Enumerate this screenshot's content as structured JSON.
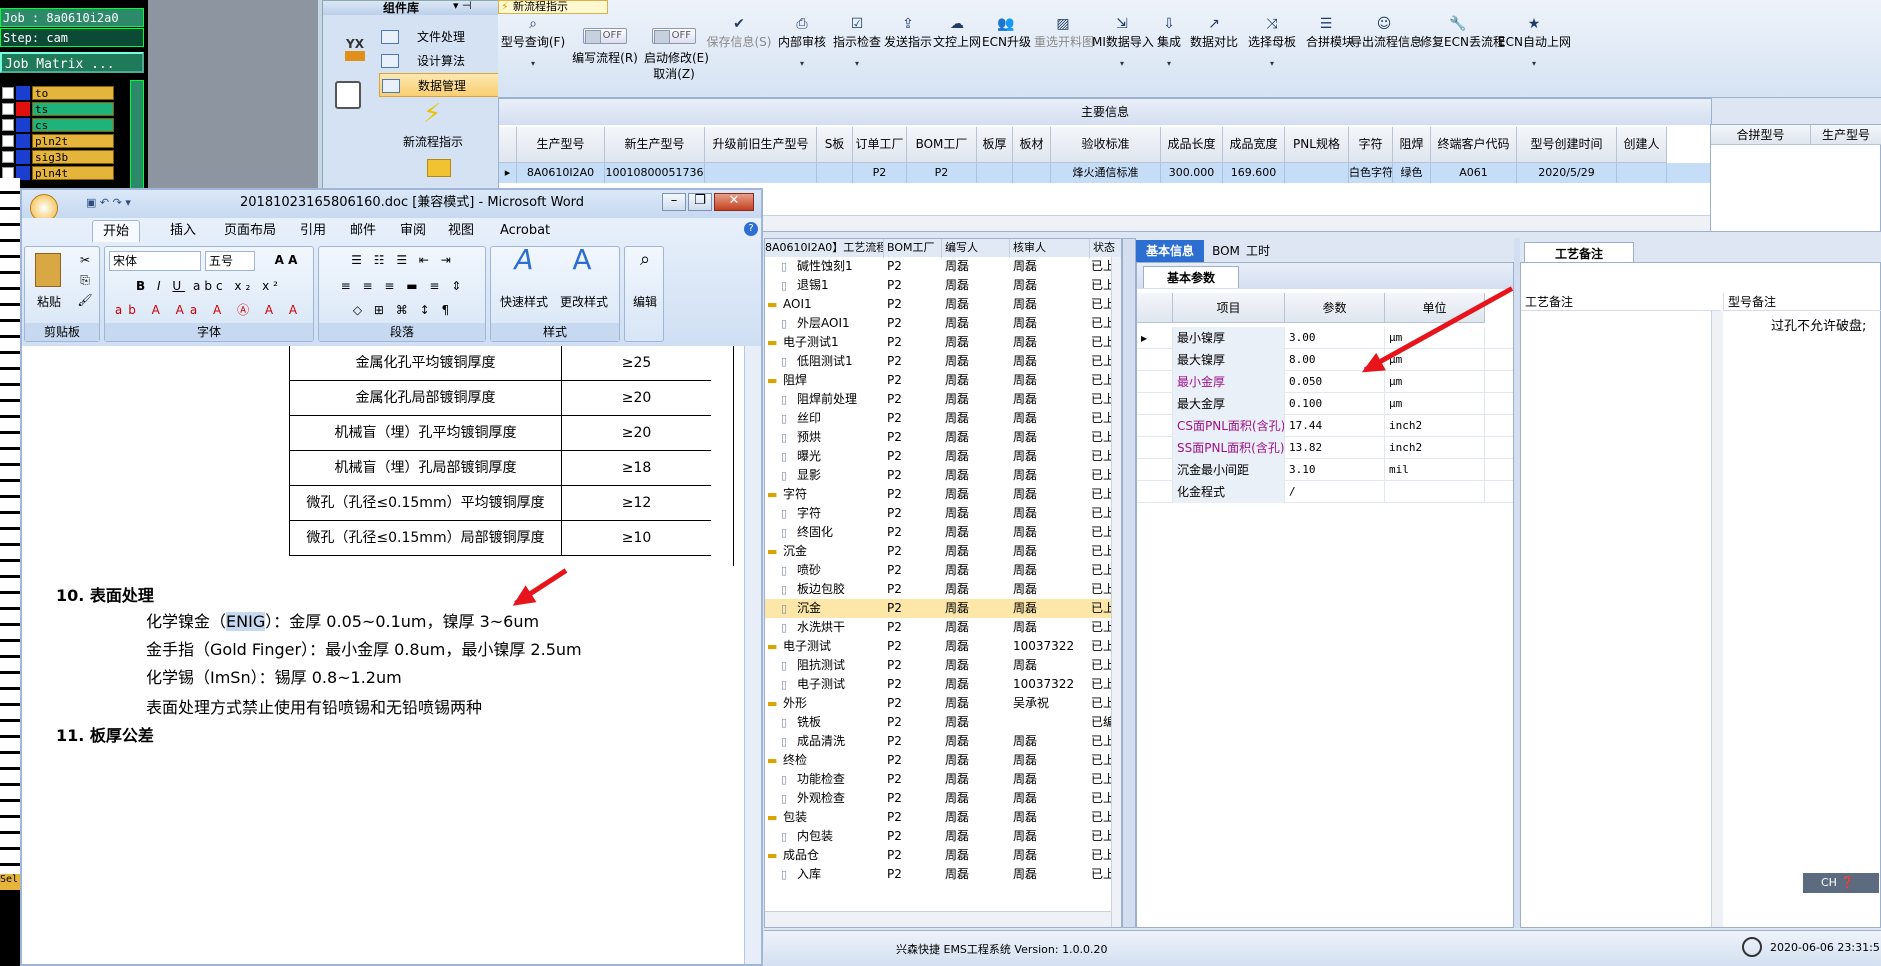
{
  "cam": {
    "job": "Job : 8a0610i2a0",
    "step": "Step: cam",
    "matrix_btn": "Job Matrix ...",
    "layers": [
      "to",
      "ts",
      "cs",
      "pln2t",
      "sig3b",
      "pln4t"
    ],
    "sel_label": "Sel"
  },
  "complib": {
    "title": "组件库",
    "items": [
      "文件处理",
      "设计算法",
      "数据管理"
    ],
    "new_flow": "新流程指示",
    "logo_text": "YX"
  },
  "app_tab": "新流程指示",
  "toolbar": {
    "buttons": [
      {
        "label": "型号查询(F)",
        "icon": "search-icon"
      },
      {
        "label": "编写流程(R)",
        "icon": "toggle-off"
      },
      {
        "label": "启动修改(E)",
        "label2": "取消(Z)",
        "icon": "toggle-off"
      },
      {
        "label": "保存信息(S)",
        "icon": "check-icon"
      },
      {
        "label": "内部审核",
        "icon": "printer-icon"
      },
      {
        "label": "指示检查",
        "icon": "checklist-icon"
      },
      {
        "label": "发送指示",
        "icon": "upload-icon"
      },
      {
        "label": "文控上网",
        "icon": "cloud-icon"
      },
      {
        "label": "ECN升级",
        "icon": "people-icon"
      },
      {
        "label": "重选开料图",
        "icon": "image-icon"
      },
      {
        "label": "MI数据导入",
        "icon": "import-icon"
      },
      {
        "label": "集成",
        "icon": "download-icon"
      },
      {
        "label": "数据对比",
        "icon": "compare-icon"
      },
      {
        "label": "选择母板",
        "icon": "shuffle-icon"
      },
      {
        "label": "合拼模块",
        "icon": "list-icon"
      },
      {
        "label": "导出流程信息",
        "icon": "smile-icon"
      },
      {
        "label": "修复ECN丢流程",
        "icon": "wrench-icon"
      },
      {
        "label": "ECN自动上网",
        "icon": "star-icon"
      }
    ],
    "toggle_text": "OFF"
  },
  "main_info": {
    "title": "主要信息",
    "columns": [
      "生产型号",
      "新生产型号",
      "升级前旧生产型号",
      "S板",
      "订单工厂",
      "BOM工厂",
      "板厚",
      "板材",
      "验收标准",
      "成品长度",
      "成品宽度",
      "PNL规格",
      "字符",
      "阻焊",
      "终端客户代码",
      "型号创建时间",
      "创建人"
    ],
    "row": [
      "8A0610I2A0",
      "10010800051736",
      "",
      "",
      "P2",
      "P2",
      "",
      "",
      "烽火通信标准",
      "300.000",
      "169.600",
      "",
      "白色字符",
      "绿色",
      "A061",
      "2020/5/29",
      ""
    ],
    "merge_columns": [
      "合拼型号",
      "生产型号"
    ]
  },
  "word": {
    "title": "20181023165806160.doc [兼容模式] - Microsoft Word",
    "tabs": [
      "开始",
      "插入",
      "页面布局",
      "引用",
      "邮件",
      "审阅",
      "视图",
      "Acrobat"
    ],
    "groups": [
      "剪贴板",
      "字体",
      "段落",
      "样式",
      "编辑"
    ],
    "paste": "粘贴",
    "font_name": "宋体",
    "font_size": "五号",
    "quick_style": "快速样式",
    "change_style": "更改样式",
    "edit": "编辑",
    "table_rows": [
      [
        "金属化孔平均镀铜厚度",
        "≥25"
      ],
      [
        "金属化孔局部镀铜厚度",
        "≥20"
      ],
      [
        "机械盲（埋）孔平均镀铜厚度",
        "≥20"
      ],
      [
        "机械盲（埋）孔局部镀铜厚度",
        "≥18"
      ],
      [
        "微孔（孔径≤0.15mm）平均镀铜厚度",
        "≥12"
      ],
      [
        "微孔（孔径≤0.15mm）局部镀铜厚度",
        "≥10"
      ]
    ],
    "heading10": "10. 表面处理",
    "line1_a": "化学镍金（",
    "line1_b": "ENIG",
    "line1_c": "）：金厚 0.05~0.1um，镍厚 3~6um",
    "line2": "金手指（Gold Finger）：最小金厚 0.8um，最小镍厚 2.5um",
    "line3": "化学锡（ImSn）：锡厚 0.8~1.2um",
    "line4": "表面处理方式禁止使用有铅喷锡和无铅喷锡两种",
    "heading11": "11. 板厚公差"
  },
  "tree": {
    "header_title": "8A0610I2A0】工艺流程",
    "columns": [
      "",
      "BOM工厂",
      "编写人",
      "核审人",
      "状态"
    ],
    "rows": [
      {
        "name": "碱性蚀刻1",
        "lvl": 2,
        "f": "P2",
        "w": "周磊",
        "r": "周磊",
        "s": "已上"
      },
      {
        "name": "退锡1",
        "lvl": 2,
        "f": "P2",
        "w": "周磊",
        "r": "周磊",
        "s": "已上"
      },
      {
        "name": "AOI1",
        "lvl": 1,
        "f": "P2",
        "w": "周磊",
        "r": "周磊",
        "s": "已上"
      },
      {
        "name": "外层AOI1",
        "lvl": 2,
        "f": "P2",
        "w": "周磊",
        "r": "周磊",
        "s": "已上"
      },
      {
        "name": "电子测试1",
        "lvl": 1,
        "f": "P2",
        "w": "周磊",
        "r": "周磊",
        "s": "已上"
      },
      {
        "name": "低阻测试1",
        "lvl": 2,
        "f": "P2",
        "w": "周磊",
        "r": "周磊",
        "s": "已上"
      },
      {
        "name": "阻焊",
        "lvl": 1,
        "f": "P2",
        "w": "周磊",
        "r": "周磊",
        "s": "已上"
      },
      {
        "name": "阻焊前处理",
        "lvl": 2,
        "f": "P2",
        "w": "周磊",
        "r": "周磊",
        "s": "已上"
      },
      {
        "name": "丝印",
        "lvl": 2,
        "f": "P2",
        "w": "周磊",
        "r": "周磊",
        "s": "已上"
      },
      {
        "name": "预烘",
        "lvl": 2,
        "f": "P2",
        "w": "周磊",
        "r": "周磊",
        "s": "已上"
      },
      {
        "name": "曝光",
        "lvl": 2,
        "f": "P2",
        "w": "周磊",
        "r": "周磊",
        "s": "已上"
      },
      {
        "name": "显影",
        "lvl": 2,
        "f": "P2",
        "w": "周磊",
        "r": "周磊",
        "s": "已上"
      },
      {
        "name": "字符",
        "lvl": 1,
        "f": "P2",
        "w": "周磊",
        "r": "周磊",
        "s": "已上"
      },
      {
        "name": "字符",
        "lvl": 2,
        "f": "P2",
        "w": "周磊",
        "r": "周磊",
        "s": "已上"
      },
      {
        "name": "终固化",
        "lvl": 2,
        "f": "P2",
        "w": "周磊",
        "r": "周磊",
        "s": "已上"
      },
      {
        "name": "沉金",
        "lvl": 1,
        "f": "P2",
        "w": "周磊",
        "r": "周磊",
        "s": "已上"
      },
      {
        "name": "喷砂",
        "lvl": 2,
        "f": "P2",
        "w": "周磊",
        "r": "周磊",
        "s": "已上"
      },
      {
        "name": "板边包胶",
        "lvl": 2,
        "f": "P2",
        "w": "周磊",
        "r": "周磊",
        "s": "已上"
      },
      {
        "name": "沉金",
        "lvl": 2,
        "f": "P2",
        "w": "周磊",
        "r": "周磊",
        "s": "已上",
        "sel": true
      },
      {
        "name": "水洗烘干",
        "lvl": 2,
        "f": "P2",
        "w": "周磊",
        "r": "周磊",
        "s": "已上"
      },
      {
        "name": "电子测试",
        "lvl": 1,
        "f": "P2",
        "w": "周磊",
        "r": "10037322",
        "s": "已上"
      },
      {
        "name": "阻抗测试",
        "lvl": 2,
        "f": "P2",
        "w": "周磊",
        "r": "周磊",
        "s": "已上"
      },
      {
        "name": "电子测试",
        "lvl": 2,
        "f": "P2",
        "w": "周磊",
        "r": "10037322",
        "s": "已上"
      },
      {
        "name": "外形",
        "lvl": 1,
        "f": "P2",
        "w": "周磊",
        "r": "吴承祝",
        "s": "已上"
      },
      {
        "name": "铣板",
        "lvl": 2,
        "f": "P2",
        "w": "周磊",
        "r": "",
        "s": "已编"
      },
      {
        "name": "成品清洗",
        "lvl": 2,
        "f": "P2",
        "w": "周磊",
        "r": "周磊",
        "s": "已上"
      },
      {
        "name": "终检",
        "lvl": 1,
        "f": "P2",
        "w": "周磊",
        "r": "周磊",
        "s": "已上"
      },
      {
        "name": "功能检查",
        "lvl": 2,
        "f": "P2",
        "w": "周磊",
        "r": "周磊",
        "s": "已上"
      },
      {
        "name": "外观检查",
        "lvl": 2,
        "f": "P2",
        "w": "周磊",
        "r": "周磊",
        "s": "已上"
      },
      {
        "name": "包装",
        "lvl": 1,
        "f": "P2",
        "w": "周磊",
        "r": "周磊",
        "s": "已上"
      },
      {
        "name": "内包装",
        "lvl": 2,
        "f": "P2",
        "w": "周磊",
        "r": "周磊",
        "s": "已上"
      },
      {
        "name": "成品仓",
        "lvl": 1,
        "f": "P2",
        "w": "周磊",
        "r": "周磊",
        "s": "已上"
      },
      {
        "name": "入库",
        "lvl": 2,
        "f": "P2",
        "w": "周磊",
        "r": "周磊",
        "s": "已上"
      }
    ]
  },
  "basic": {
    "tabs": [
      "基本信息",
      "BOM",
      "工时"
    ],
    "subtab": "基本参数",
    "columns": [
      "项目",
      "参数",
      "单位"
    ],
    "rows": [
      {
        "item": "最小镍厚",
        "val": "3.00",
        "unit": "μm",
        "color": "#000000"
      },
      {
        "item": "最大镍厚",
        "val": "8.00",
        "unit": "μm",
        "color": "#000000"
      },
      {
        "item": "最小金厚",
        "val": "0.050",
        "unit": "μm",
        "color": "#a0108a"
      },
      {
        "item": "最大金厚",
        "val": "0.100",
        "unit": "μm",
        "color": "#000000"
      },
      {
        "item": "CS面PNL面积(含孔)",
        "val": "17.44",
        "unit": "inch2",
        "color": "#a0108a"
      },
      {
        "item": "SS面PNL面积(含孔)",
        "val": "13.82",
        "unit": "inch2",
        "color": "#a0108a"
      },
      {
        "item": "沉金最小间距",
        "val": "3.10",
        "unit": "mil",
        "color": "#000000"
      },
      {
        "item": "化金程式",
        "val": "/",
        "unit": "",
        "color": "#000000"
      }
    ]
  },
  "notes": {
    "tab": "工艺备注",
    "col1": "工艺备注",
    "col2": "型号备注",
    "note_text": "过孔不允许破盘;"
  },
  "status": {
    "text": "兴森快捷 EMS工程系统 Version: 1.0.0.20",
    "datetime": "2020-06-06 23:31:5",
    "ime": "CH"
  }
}
